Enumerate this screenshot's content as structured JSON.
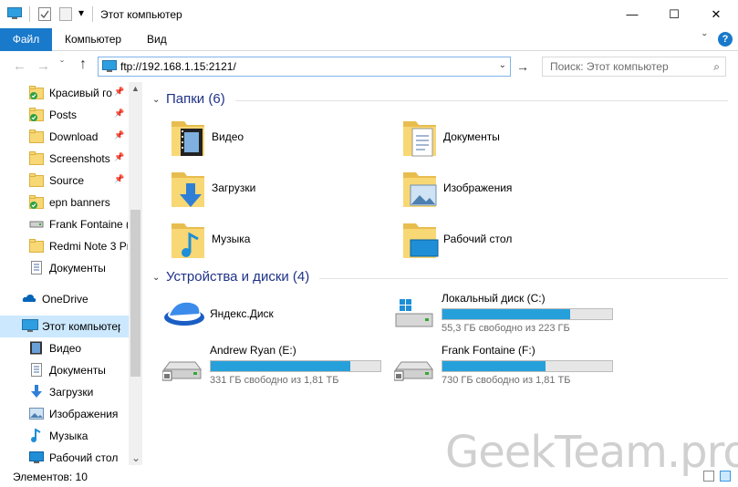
{
  "window": {
    "title": "Этот компьютер",
    "minimize_icon": "—",
    "maximize_icon": "☐",
    "close_icon": "✕",
    "qa_dropdown": "▾"
  },
  "ribbon": {
    "tabs": [
      "Файл",
      "Компьютер",
      "Вид"
    ],
    "collapse_icon": "ˇ",
    "help_icon": "?"
  },
  "address": {
    "back": "←",
    "forward": "→",
    "recent": "ˇ",
    "up": "↑",
    "path": "ftp://192.168.1.15:2121/",
    "dropdown": "⌄",
    "go": "→"
  },
  "search": {
    "placeholder": "Поиск: Этот компьютер",
    "icon": "⌕"
  },
  "nav": {
    "items": [
      {
        "label": "Красивый го",
        "icon": "folder-sync",
        "pin": "📌"
      },
      {
        "label": "Posts",
        "icon": "folder-sync",
        "pin": "📌"
      },
      {
        "label": "Download",
        "icon": "folder",
        "pin": "📌"
      },
      {
        "label": "Screenshots",
        "icon": "folder",
        "pin": "📌"
      },
      {
        "label": "Source",
        "icon": "folder",
        "pin": "📌"
      },
      {
        "label": "epn banners",
        "icon": "folder-sync",
        "pin": ""
      },
      {
        "label": "Frank Fontaine (",
        "icon": "drive",
        "pin": ""
      },
      {
        "label": "Redmi Note 3 Pr",
        "icon": "folder",
        "pin": ""
      },
      {
        "label": "Документы",
        "icon": "doc",
        "pin": ""
      },
      {
        "label": "OneDrive",
        "icon": "cloud",
        "pin": ""
      },
      {
        "label": "Этот компьютер",
        "icon": "pc",
        "pin": ""
      },
      {
        "label": "Видео",
        "icon": "video",
        "pin": ""
      },
      {
        "label": "Документы",
        "icon": "doc",
        "pin": ""
      },
      {
        "label": "Загрузки",
        "icon": "download",
        "pin": ""
      },
      {
        "label": "Изображения",
        "icon": "picture",
        "pin": ""
      },
      {
        "label": "Музыка",
        "icon": "music",
        "pin": ""
      },
      {
        "label": "Рабочий стол",
        "icon": "desktop",
        "pin": ""
      }
    ],
    "scroll_up": "▲",
    "scroll_down": "⌄"
  },
  "content": {
    "folders_header": "Папки (6)",
    "folders": [
      {
        "name": "Видео",
        "icon": "video"
      },
      {
        "name": "Документы",
        "icon": "doc"
      },
      {
        "name": "Загрузки",
        "icon": "download"
      },
      {
        "name": "Изображения",
        "icon": "picture"
      },
      {
        "name": "Музыка",
        "icon": "music"
      },
      {
        "name": "Рабочий стол",
        "icon": "desktop"
      }
    ],
    "devices_header": "Устройства и диски (4)",
    "devices": [
      {
        "name": "Яндекс.Диск",
        "icon": "yandex-disk",
        "free": "",
        "used_fraction": null
      },
      {
        "name": "Локальный диск (C:)",
        "icon": "windows-drive",
        "free": "55,3 ГБ свободно из 223 ГБ",
        "used_fraction": 0.75
      },
      {
        "name": "Andrew Ryan (E:)",
        "icon": "drive",
        "free": "331 ГБ свободно из 1,81 ТБ",
        "used_fraction": 0.82
      },
      {
        "name": "Frank Fontaine (F:)",
        "icon": "drive",
        "free": "730 ГБ свободно из 1,81 ТБ",
        "used_fraction": 0.61
      }
    ]
  },
  "status": {
    "text": "Элементов: 10"
  },
  "watermark": "GeekTeam.pro",
  "colors": {
    "accent": "#1979ca",
    "bar_fill": "#26a0da",
    "section_header": "#1e3287",
    "selection": "#cce8ff"
  }
}
